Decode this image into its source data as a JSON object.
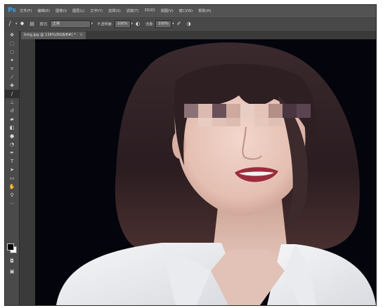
{
  "app": {
    "logo": "Ps"
  },
  "menu": {
    "items": [
      {
        "label": "文件(F)"
      },
      {
        "label": "编辑(E)"
      },
      {
        "label": "图像(I)"
      },
      {
        "label": "图层(L)"
      },
      {
        "label": "文字(Y)"
      },
      {
        "label": "选择(S)"
      },
      {
        "label": "滤镜(T)"
      },
      {
        "label": "3D(D)"
      },
      {
        "label": "视图(V)"
      },
      {
        "label": "窗口(W)"
      },
      {
        "label": "帮助(H)"
      }
    ]
  },
  "options": {
    "mode_label": "模式:",
    "mode_value": "正常",
    "opacity_label": "不透明度:",
    "opacity_value": "100%",
    "flow_label": "流量:",
    "flow_value": "100%"
  },
  "document": {
    "tab_title": "timg.jpg @ 136%(RGB/8#) *",
    "close_glyph": "×"
  },
  "tools": [
    {
      "icon": "move-icon",
      "glyph": "✥"
    },
    {
      "icon": "marquee-icon",
      "glyph": "⬚"
    },
    {
      "icon": "lasso-icon",
      "glyph": "◌"
    },
    {
      "icon": "magic-wand-icon",
      "glyph": "✦"
    },
    {
      "icon": "crop-icon",
      "glyph": "⌗"
    },
    {
      "icon": "eyedropper-icon",
      "glyph": "⁄"
    },
    {
      "icon": "healing-icon",
      "glyph": "✚"
    },
    {
      "icon": "brush-icon",
      "glyph": "∕"
    },
    {
      "icon": "stamp-icon",
      "glyph": "⊥"
    },
    {
      "icon": "history-brush-icon",
      "glyph": "↺"
    },
    {
      "icon": "eraser-icon",
      "glyph": "▰"
    },
    {
      "icon": "gradient-icon",
      "glyph": "◧"
    },
    {
      "icon": "blur-icon",
      "glyph": "●"
    },
    {
      "icon": "dodge-icon",
      "glyph": "◔"
    },
    {
      "icon": "pen-icon",
      "glyph": "✒"
    },
    {
      "icon": "type-icon",
      "glyph": "T"
    },
    {
      "icon": "path-select-icon",
      "glyph": "➤"
    },
    {
      "icon": "shape-icon",
      "glyph": "▭"
    },
    {
      "icon": "hand-icon",
      "glyph": "✋"
    },
    {
      "icon": "zoom-icon",
      "glyph": "⚲"
    }
  ],
  "colors": {
    "foreground": "#000000",
    "background": "#ffffff",
    "accent": "#3aa0e8"
  }
}
